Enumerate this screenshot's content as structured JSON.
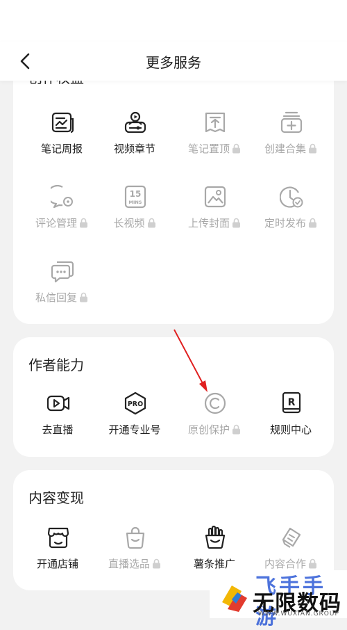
{
  "header": {
    "title": "更多服务"
  },
  "sections": [
    {
      "title": "创作权益",
      "items": [
        {
          "label": "笔记周报",
          "icon": "note-report-icon",
          "enabled": true
        },
        {
          "label": "视频章节",
          "icon": "video-chapter-icon",
          "enabled": true
        },
        {
          "label": "笔记置顶",
          "icon": "pin-note-icon",
          "enabled": false
        },
        {
          "label": "创建合集",
          "icon": "create-collection-icon",
          "enabled": false
        },
        {
          "label": "评论管理",
          "icon": "comment-manage-icon",
          "enabled": false
        },
        {
          "label": "长视频",
          "icon": "long-video-icon",
          "enabled": false
        },
        {
          "label": "上传封面",
          "icon": "upload-cover-icon",
          "enabled": false
        },
        {
          "label": "定时发布",
          "icon": "scheduled-publish-icon",
          "enabled": false
        },
        {
          "label": "私信回复",
          "icon": "message-reply-icon",
          "enabled": false
        }
      ]
    },
    {
      "title": "作者能力",
      "items": [
        {
          "label": "去直播",
          "icon": "live-icon",
          "enabled": true
        },
        {
          "label": "开通专业号",
          "icon": "pro-account-icon",
          "enabled": true
        },
        {
          "label": "原创保护",
          "icon": "copyright-icon",
          "enabled": false
        },
        {
          "label": "规则中心",
          "icon": "rules-center-icon",
          "enabled": true
        }
      ]
    },
    {
      "title": "内容变现",
      "items": [
        {
          "label": "开通店铺",
          "icon": "store-icon",
          "enabled": true
        },
        {
          "label": "直播选品",
          "icon": "live-selection-icon",
          "enabled": false
        },
        {
          "label": "薯条推广",
          "icon": "fries-promotion-icon",
          "enabled": true
        },
        {
          "label": "内容合作",
          "icon": "content-cooperation-icon",
          "enabled": false
        }
      ]
    }
  ],
  "icon_text": {
    "long_video_top": "15",
    "long_video_bottom": "MINS",
    "pro": "PRO",
    "rules": "R"
  },
  "watermark": {
    "top": "飞手手游",
    "brand": "无限数码",
    "sub": "WWW.WUXIAN.GROUP"
  },
  "colors": {
    "enabled": "#222222",
    "disabled": "#a8a8a8",
    "arrow": "#e02020",
    "background": "#f2f2f2"
  }
}
